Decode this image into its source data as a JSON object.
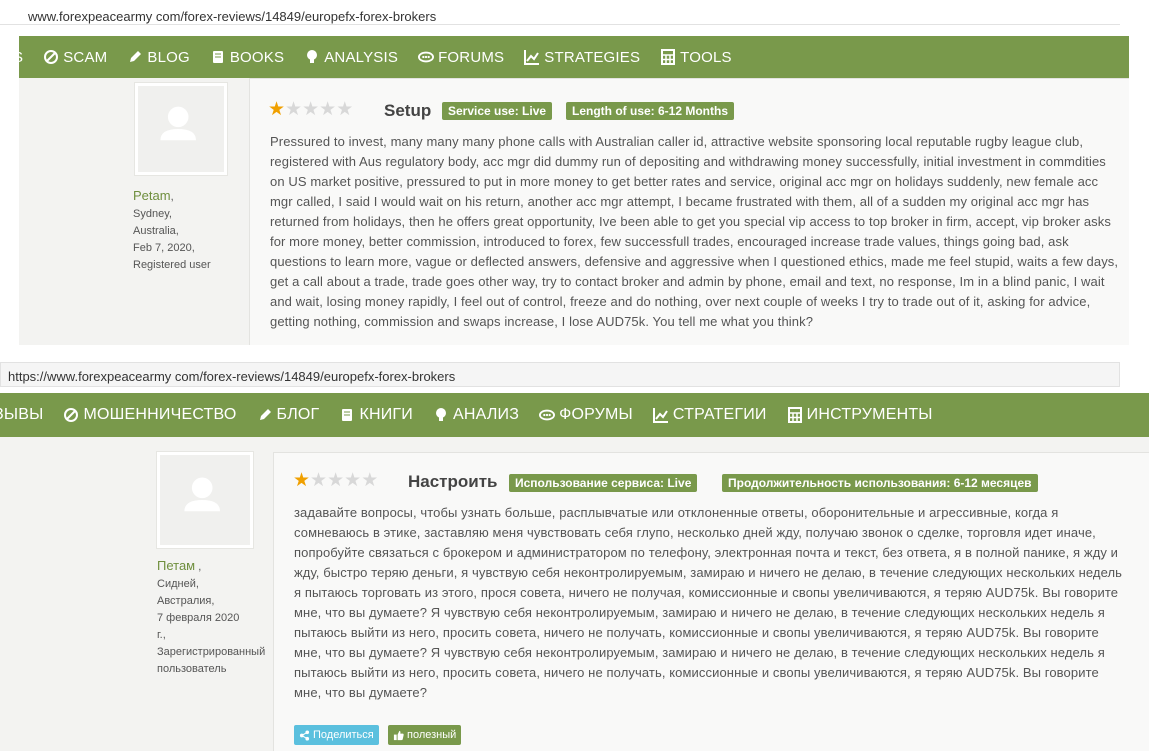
{
  "en": {
    "url": "www.forexpeacearmy com/forex-reviews/14849/europefx-forex-brokers",
    "nav": [
      {
        "icon": "nav-truncated",
        "label": "S"
      },
      {
        "icon": "ban-icon",
        "label": "SCAM"
      },
      {
        "icon": "pencil-icon",
        "label": "BLOG"
      },
      {
        "icon": "book-icon",
        "label": "BOOKS"
      },
      {
        "icon": "bulb-icon",
        "label": "ANALYSIS"
      },
      {
        "icon": "chat-icon",
        "label": "FORUMS"
      },
      {
        "icon": "chart-icon",
        "label": "STRATEGIES"
      },
      {
        "icon": "calculator-icon",
        "label": "TOOLS"
      }
    ],
    "user": {
      "name": "Petam",
      "comma": ",",
      "city": "Sydney,",
      "country": "Australia,",
      "date": "Feb 7, 2020,",
      "status": "Registered user"
    },
    "rating": 1,
    "title": "Setup",
    "tag1": "Service use: Live",
    "tag2": "Length of use: 6-12 Months",
    "text": "Pressured to invest, many many many phone calls with Australian caller id, attractive website sponsoring local reputable rugby league club, registered with Aus regulatory body, acc mgr did dummy run of depositing and withdrawing money successfully, initial investment in commdities on US market positive, pressured to put in more money to get better rates and service, original acc mgr on holidays suddenly, new female acc mgr called, I said I would wait on his return, another acc mgr attempt, I became frustrated with them, all of a sudden my original acc mgr has returned from holidays, then he offers great opportunity, Ive been able to get you special vip access to top broker in firm, accept, vip broker asks for more money, better commission, introduced to forex, few successfull trades, encouraged increase trade values, things going bad, ask questions to learn more, vague or deflected answers, defensive and aggressive when I questioned ethics, made me feel stupid, waits a few days, get a call about a trade, trade goes other way, try to contact broker and admin by phone, email and text, no response, Im in a blind panic, I wait and wait, losing money rapidly, I feel out of control, freeze and do nothing, over next couple of weeks I try to trade out of it, asking for advice, getting nothing, commission and swaps increase, I lose AUD75k. You tell me what you think?"
  },
  "ru": {
    "url": "https://www.forexpeacearmy com/forex-reviews/14849/europefx-forex-brokers",
    "nav": [
      {
        "icon": "nav-truncated",
        "label": "ЗЫВЫ"
      },
      {
        "icon": "ban-icon",
        "label": "МОШЕННИЧЕСТВО"
      },
      {
        "icon": "pencil-icon",
        "label": "БЛОГ"
      },
      {
        "icon": "book-icon",
        "label": "КНИГИ"
      },
      {
        "icon": "bulb-icon",
        "label": "АНАЛИЗ"
      },
      {
        "icon": "chat-icon",
        "label": "ФОРУМЫ"
      },
      {
        "icon": "chart-icon",
        "label": "СТРАТЕГИИ"
      },
      {
        "icon": "calculator-icon",
        "label": "ИНСТРУМЕНТЫ"
      }
    ],
    "user": {
      "name": "Петам",
      "comma": ",",
      "city": "Сидней,",
      "country": "Австралия,",
      "date": "7 февраля 2020 г.,",
      "status": "Зарегистрированный пользователь"
    },
    "rating": 1,
    "title": "Настроить",
    "tag1": "Использование сервиса: Live",
    "tag2": "Продолжительность использования: 6-12 месяцев",
    "text": "задавайте вопросы, чтобы узнать больше, расплывчатые или отклоненные ответы, оборонительные и агрессивные, когда я сомневаюсь в этике, заставляю меня чувствовать себя глупо, несколько дней жду, получаю звонок о сделке, торговля идет иначе, попробуйте связаться с брокером и администратором по телефону, электронная почта и текст, без ответа, я в полной панике, я жду и жду, быстро теряю деньги, я чувствую себя неконтролируемым, замираю и ничего не делаю, в течение следующих нескольких недель я пытаюсь торговать из этого, прося совета, ничего не получая, комиссионные и свопы увеличиваются, я теряю AUD75k. Вы говорите мне, что вы думаете? Я чувствую себя неконтролируемым, замираю и ничего не делаю, в течение следующих нескольких недель я пытаюсь выйти из него, просить совета, ничего не получать, комиссионные и свопы увеличиваются, я теряю AUD75k. Вы говорите мне, что вы думаете? Я чувствую себя неконтролируемым, замираю и ничего не делаю, в течение следующих нескольких недель я пытаюсь выйти из него, просить совета, ничего не получать, комиссионные и свопы увеличиваются, я теряю AUD75k. Вы говорите мне, что вы думаете?",
    "share_label": "Поделиться",
    "useful_label": "полезный"
  },
  "colors": {
    "nav_green": "#79994b",
    "star_on": "#f0a000",
    "star_off": "#d8d8d8",
    "share_blue": "#5bc0de"
  }
}
